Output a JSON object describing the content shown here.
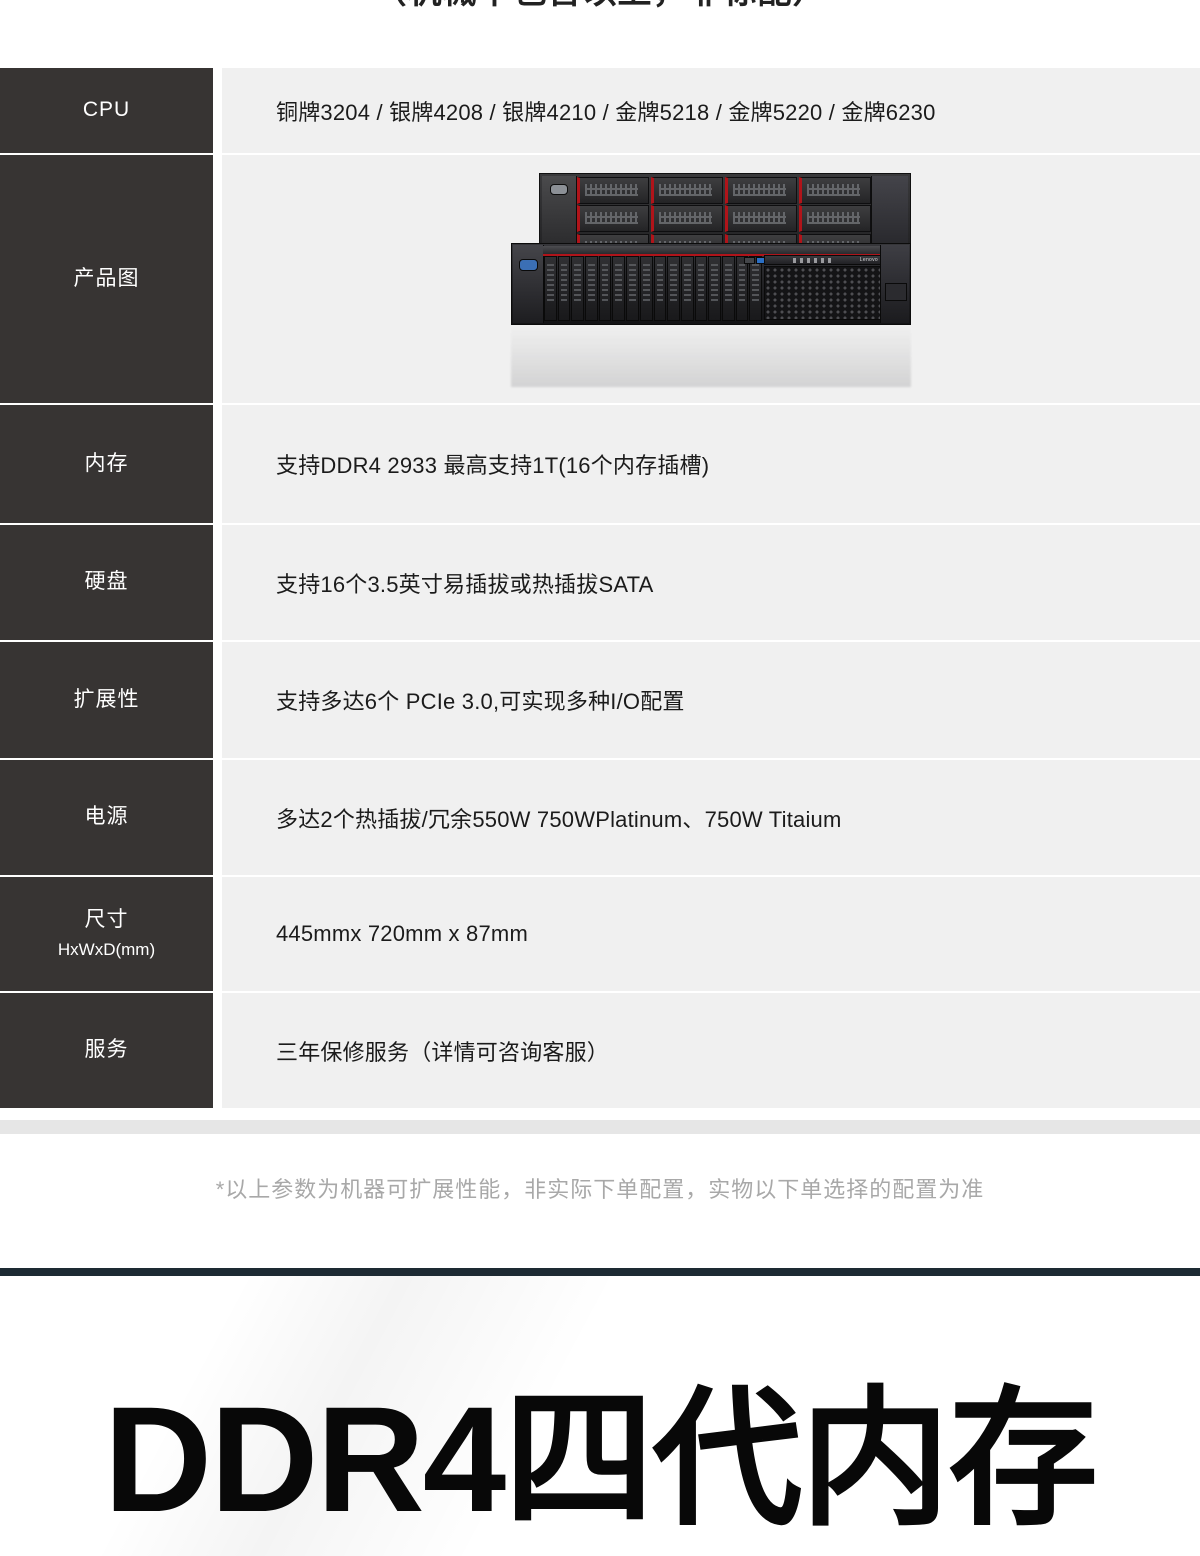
{
  "top_heading_clipped": "（机械不包含以上，非标配）",
  "spec_table": {
    "rows": [
      {
        "label": "CPU",
        "sublabel": "",
        "value": "铜牌3204 / 银牌4208 / 银牌4210 / 金牌5218 / 金牌5220 / 金牌6230",
        "type": "text"
      },
      {
        "label": "产品图",
        "sublabel": "",
        "value": "",
        "type": "image",
        "image_alt": "lenovo-rack-server-photo"
      },
      {
        "label": "内存",
        "sublabel": "",
        "value": "支持DDR4 2933 最高支持1T(16个内存插槽)",
        "type": "text"
      },
      {
        "label": "硬盘",
        "sublabel": "",
        "value": "支持16个3.5英寸易插拔或热插拔SATA",
        "type": "text"
      },
      {
        "label": "扩展性",
        "sublabel": "",
        "value": "支持多达6个 PCIe 3.0,可实现多种I/O配置",
        "type": "text"
      },
      {
        "label": "电源",
        "sublabel": "",
        "value": "多达2个热插拔/冗余550W 750WPlatinum、750W  Titaium",
        "type": "text"
      },
      {
        "label": "尺寸",
        "sublabel": "HxWxD(mm)",
        "value": "445mmx 720mm x 87mm",
        "type": "text"
      },
      {
        "label": "服务",
        "sublabel": "",
        "value": "三年保修服务（详情可咨询客服）",
        "type": "text"
      }
    ]
  },
  "footnote": "*以上参数为机器可扩展性能，非实际下单配置，实物以下单选择的配置为准",
  "banner": {
    "title": "DDR4四代内存"
  },
  "product_photo": {
    "brand": "Lenovo"
  },
  "colors": {
    "label_bg": "#373433",
    "value_bg": "#f0f0f0",
    "label_text": "#ffffff",
    "value_text": "#1b1b1b",
    "footnote_text": "#a8a8a8",
    "divider_bar": "#1d2a33",
    "page_bg": "#ffffff",
    "accent_red": "#b0141a"
  }
}
